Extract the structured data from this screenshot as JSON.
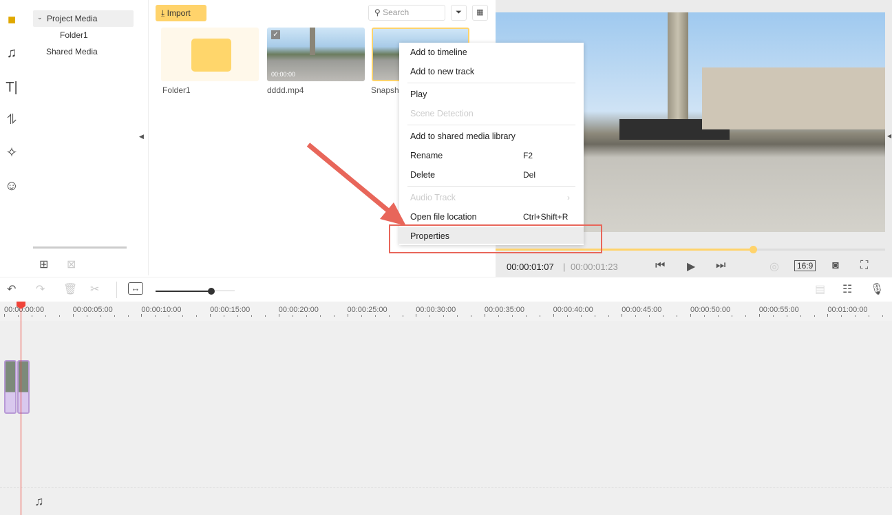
{
  "sidebar": {
    "icons": [
      "media-folder-icon",
      "music-icon",
      "text-icon",
      "transition-icon",
      "effects-icon",
      "sticker-icon"
    ]
  },
  "tree": {
    "items": [
      {
        "label": "Project Media",
        "expanded": true
      },
      {
        "label": "Folder1"
      },
      {
        "label": "Shared Media"
      }
    ]
  },
  "media": {
    "import_label": "Import",
    "search_placeholder": "Search",
    "items": [
      {
        "name": "Folder1",
        "type": "folder"
      },
      {
        "name": "dddd.mp4",
        "type": "video",
        "duration": "00:00:00"
      },
      {
        "name": "Snapsho",
        "type": "image"
      }
    ]
  },
  "context_menu": {
    "items": [
      {
        "label": "Add to timeline"
      },
      {
        "label": "Add to new track"
      },
      {
        "label": "Play"
      },
      {
        "label": "Scene Detection",
        "disabled": true
      },
      {
        "label": "Add to shared media library"
      },
      {
        "label": "Rename",
        "shortcut": "F2"
      },
      {
        "label": "Delete",
        "shortcut": "Del"
      },
      {
        "label": "Audio Track",
        "disabled": true
      },
      {
        "label": "Open file location",
        "shortcut": "Ctrl+Shift+R"
      },
      {
        "label": "Properties",
        "highlighted": true
      }
    ]
  },
  "preview": {
    "current_time": "00:00:01:07",
    "total_time": "00:00:01:23",
    "progress_percent": 66,
    "aspect": "16:9"
  },
  "timeline": {
    "ruler": [
      "00:00:00:00",
      "00:00:05:00",
      "00:00:10:00",
      "00:00:15:00",
      "00:00:20:00",
      "00:00:25:00",
      "00:00:30:00",
      "00:00:35:00",
      "00:00:40:00",
      "00:00:45:00",
      "00:00:50:00",
      "00:00:55:00",
      "00:01:00:00"
    ],
    "zoom_percent": 70
  },
  "colors": {
    "accent": "#ffd36b",
    "playhead": "#f0443a",
    "annotation": "#e8665a",
    "clip": "#b89ad6"
  }
}
